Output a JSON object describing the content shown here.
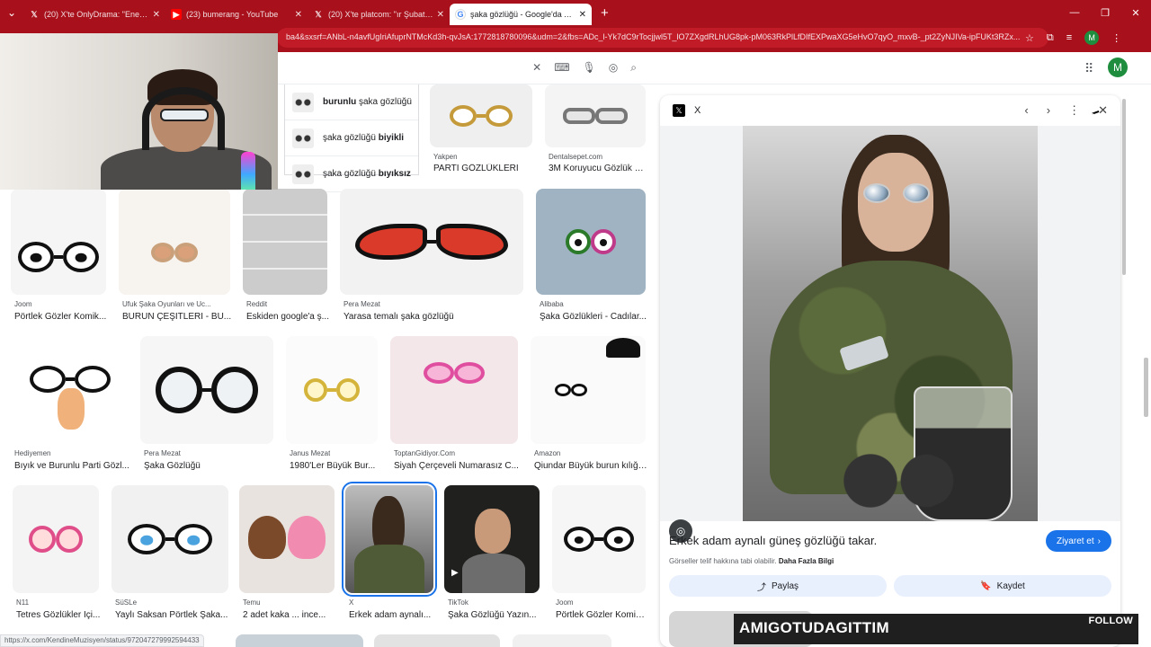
{
  "browser": {
    "tabs": [
      {
        "label": "(20) X'te OnlyDrama: \"Enes Bat",
        "icon": "x-logo-icon",
        "active": false
      },
      {
        "label": "(23) bumerang - YouTube",
        "icon": "youtube-icon",
        "active": false
      },
      {
        "label": "(20) X'te platcom: \"ır Şubat ay",
        "icon": "x-logo-icon",
        "active": false
      },
      {
        "label": "şaka gözlüğü - Google'da Ara",
        "icon": "google-icon",
        "active": true
      }
    ],
    "url": "ba4&sxsrf=ANbL-n4avfUgIriAfuprNTMcKd3h-qvJsA:1772818780096&udm=2&fbs=ADc_l-Yk7dC9rTocjjwl5T_lO7ZXgdRLhUG8pk-pM063RkPlLfDIfEXPwaXG5eHvO7qyO_mxvB-_pt2ZyNJIVa-ipFUKt3RZx...",
    "account_initial": "M",
    "status_url": "https://x.com/KendineMuzisyen/status/972047279992594433"
  },
  "google": {
    "avatar_initial": "M",
    "suggestions": [
      {
        "bold_first": "burunlu",
        "rest": " şaka gözlüğü",
        "bold_last": ""
      },
      {
        "bold_first": "",
        "rest": "şaka gözlüğü ",
        "bold_last": "biyikli"
      },
      {
        "bold_first": "",
        "rest": "şaka gözlüğü ",
        "bold_last": "bıyıksız"
      }
    ]
  },
  "results": {
    "row0": [
      {
        "source": "Yakpen",
        "title": "PARTİ GÖZLÜKLERİ"
      },
      {
        "source": "Dentalsepet.com",
        "title": "3M Koruyucu Gözlük Ş..."
      }
    ],
    "row1": [
      {
        "source": "Joom",
        "title": "Pörtlek Gözler Komik..."
      },
      {
        "source": "Ufuk Şaka Oyunları ve Uc...",
        "title": "BURUN ÇEŞİTLERİ - BU..."
      },
      {
        "source": "Reddit",
        "title": "Eskiden google'a ş..."
      },
      {
        "source": "Pera Mezat",
        "title": "Yarasa temalı şaka gözlüğü"
      },
      {
        "source": "Alibaba",
        "title": "Şaka Gözlükleri - Cadılar..."
      }
    ],
    "row2": [
      {
        "source": "Hediyemen",
        "title": "Bıyık ve Burunlu Parti Gözl..."
      },
      {
        "source": "Pera Mezat",
        "title": "Şaka Gözlüğü"
      },
      {
        "source": "Janus Mezat",
        "title": "1980'Ler Büyük Bur..."
      },
      {
        "source": "ToptanGidiyor.Com",
        "title": "Siyah Çerçeveli Numarasız C..."
      },
      {
        "source": "Amazon",
        "title": "Qiundar Büyük burun kılığı..."
      }
    ],
    "row3": [
      {
        "source": "N11",
        "title": "Tetres Gözlükler İçi..."
      },
      {
        "source": "SüSLe",
        "title": "Yaylı Saksan Pörtlek Şaka..."
      },
      {
        "source": "Temu",
        "title": "2 adet kaka ... ince..."
      },
      {
        "source": "X",
        "title": "Erkek adam aynalı..."
      },
      {
        "source": "TikTok",
        "title": "Şaka Gözlüğü Yazın..."
      },
      {
        "source": "Joom",
        "title": "Pörtlek Gözler Komik..."
      }
    ]
  },
  "panel": {
    "source": "X",
    "title": "Erkek adam aynalı güneş gözlüğü takar.",
    "visit_label": "Ziyaret et",
    "copyright_text": "Görseller telif hakkına tabi olabilir.",
    "copyright_link": "Daha Fazla Bilgi",
    "share_label": "Paylaş",
    "save_label": "Kaydet"
  },
  "stream_overlay": {
    "name": "AMIGOTUDAGITTIM",
    "follow": "FOLLOW"
  },
  "colors": {
    "browser_frame": "#a8101b",
    "accent_blue": "#1a73e8"
  }
}
